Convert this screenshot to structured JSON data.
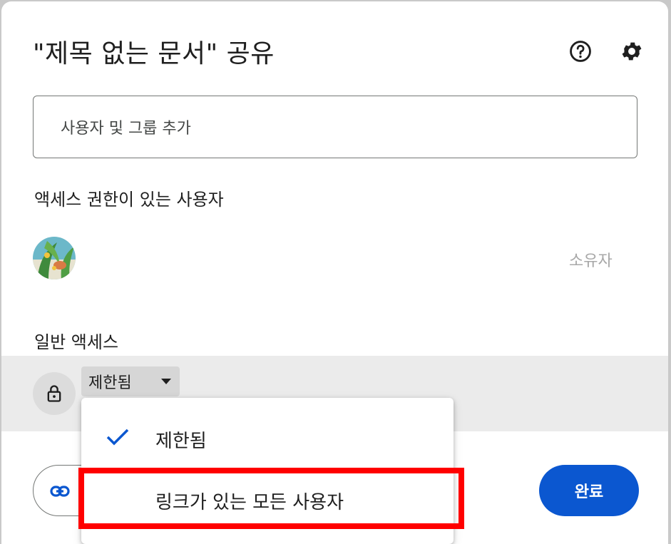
{
  "dialog": {
    "title": "\"제목 없는 문서\" 공유",
    "help_icon": "help-circle-icon",
    "settings_icon": "gear-icon"
  },
  "add_people": {
    "placeholder": "사용자 및 그룹 추가"
  },
  "people_with_access": {
    "heading": "액세스 권한이 있는 사용자",
    "owner_role": "소유자"
  },
  "general_access": {
    "heading": "일반 액세스",
    "selected": "제한됨",
    "lock_icon": "lock-icon"
  },
  "access_menu": {
    "options": [
      "제한됨",
      "링크가 있는 모든 사용자"
    ],
    "checked_index": 0
  },
  "footer": {
    "copy_link_icon": "link-icon",
    "done_label": "완료"
  },
  "colors": {
    "primary": "#0b57d0",
    "highlight": "#ff0000",
    "row_bg": "#ebebeb"
  }
}
